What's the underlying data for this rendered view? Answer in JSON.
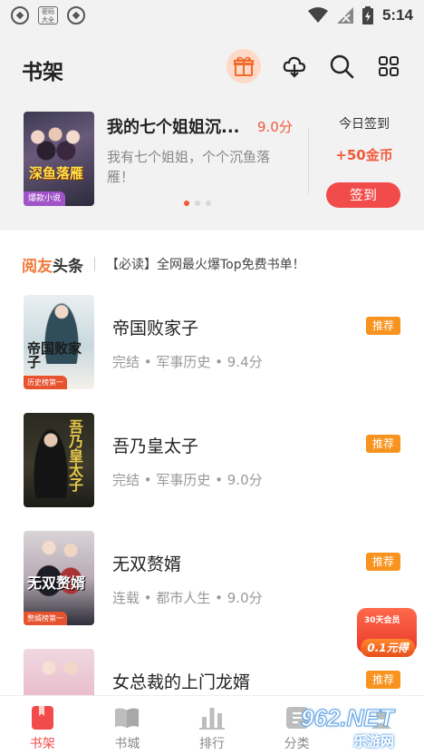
{
  "status_bar": {
    "badge": "密码\n大全",
    "time": "5:14"
  },
  "header": {
    "title": "书架"
  },
  "featured": {
    "cover_title": "深鱼落雁",
    "cover_tag": "爆款小说",
    "title": "我的七个姐姐沉...",
    "score": "9.0分",
    "description": "我有七个姐姐，个个沉鱼落雁！"
  },
  "signin": {
    "label": "今日签到",
    "reward": "+50金币",
    "button": "签到"
  },
  "ticker": {
    "logo_highlight": "阅友",
    "logo_rest": "头条",
    "text": "【必读】全网最火爆Top免费书单！"
  },
  "books": [
    {
      "title": "帝国败家子",
      "meta": "完结 • 军事历史 • 9.4分",
      "badge": "推荐",
      "cover_text": "帝国败家子",
      "cover_label": "历史榜第一"
    },
    {
      "title": "吾乃皇太子",
      "meta": "完结 • 军事历史 • 9.0分",
      "badge": "推荐",
      "cover_text": "吾乃皇太子",
      "cover_label": ""
    },
    {
      "title": "无双赘婿",
      "meta": "连载 • 都市人生 • 9.0分",
      "badge": "推荐",
      "cover_text": "无双赘婿",
      "cover_label": "赘婿榜第一"
    },
    {
      "title": "女总裁的上门龙婿",
      "meta": "",
      "badge": "推荐",
      "cover_text": "",
      "cover_label": ""
    }
  ],
  "promo": {
    "top": "30天会员",
    "pill": "0.1元得"
  },
  "nav": {
    "items": [
      {
        "label": "书架",
        "icon": "bookshelf-icon"
      },
      {
        "label": "书城",
        "icon": "book-open-icon"
      },
      {
        "label": "排行",
        "icon": "bar-chart-icon"
      },
      {
        "label": "分类",
        "icon": "category-icon"
      }
    ]
  },
  "watermark": {
    "main": "962.NET",
    "sub": "乐游网"
  },
  "colors": {
    "accent": "#f24b4b",
    "badge": "#f7931e",
    "background": "#f2f2f2"
  }
}
